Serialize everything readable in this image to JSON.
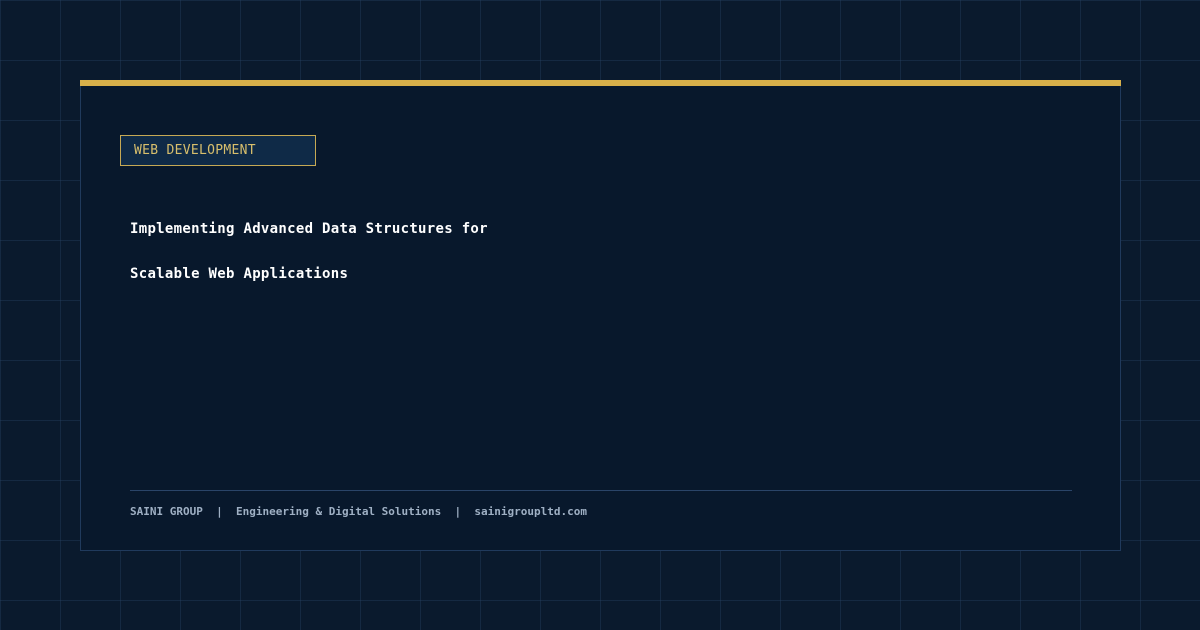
{
  "category": {
    "label": "WEB DEVELOPMENT"
  },
  "title": {
    "line1": "Implementing Advanced Data Structures for",
    "line2": "Scalable Web Applications"
  },
  "footer": {
    "company": "SAINI GROUP",
    "separator": "|",
    "tagline": "Engineering & Digital Solutions",
    "website": "sainigroupltd.com"
  },
  "colors": {
    "background": "#0a1a2d",
    "card": "#08182c",
    "accent": "#d8b04a",
    "tag_text": "#d8bf6c",
    "title_text": "#ffffff",
    "footer_text": "#9fb0c4"
  }
}
